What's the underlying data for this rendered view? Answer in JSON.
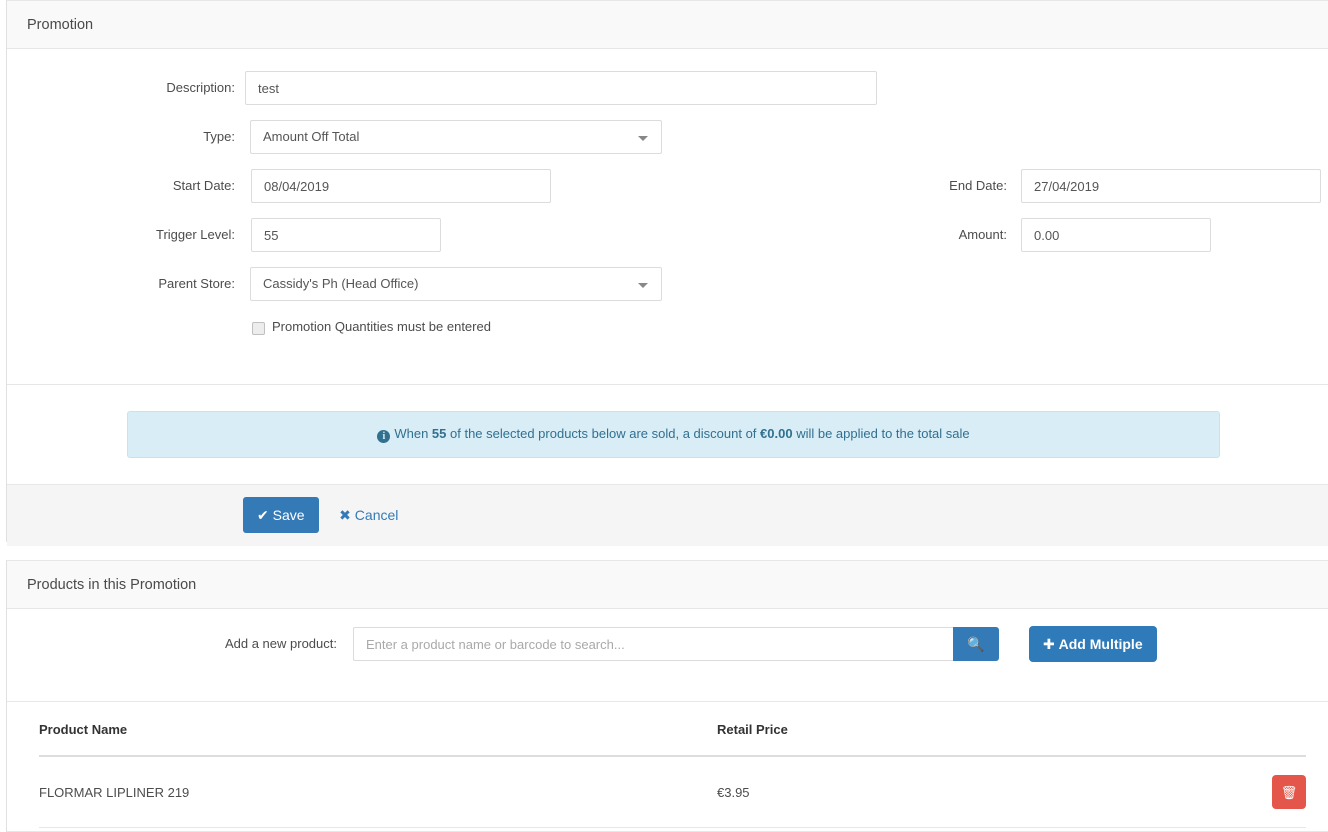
{
  "promotion_panel": {
    "title": "Promotion",
    "fields": {
      "description": {
        "label": "Description:",
        "value": "test"
      },
      "type": {
        "label": "Type:",
        "value": "Amount Off Total"
      },
      "start_date": {
        "label": "Start Date:",
        "value": "08/04/2019"
      },
      "end_date": {
        "label": "End Date:",
        "value": "27/04/2019"
      },
      "trigger_level": {
        "label": "Trigger Level:",
        "value": "55"
      },
      "amount": {
        "label": "Amount:",
        "value": "0.00"
      },
      "parent_store": {
        "label": "Parent Store:",
        "value": "Cassidy's Ph (Head Office)"
      }
    },
    "checkbox": {
      "label": "Promotion Quantities must be entered",
      "checked": false
    },
    "alert": {
      "icon": "info-circle-icon",
      "prefix": "When ",
      "trigger_value": "55",
      "middle": " of the selected products below are sold, a discount of ",
      "amount_value": "€0.00",
      "suffix": " will be applied to the total sale"
    },
    "footer": {
      "save_label": "Save",
      "save_icon": "✔",
      "cancel_label": "Cancel",
      "cancel_icon": "✖"
    }
  },
  "products_panel": {
    "title": "Products in this Promotion",
    "search": {
      "label": "Add a new product:",
      "placeholder": "Enter a product name or barcode to search...",
      "value": "",
      "search_icon": "🔍",
      "add_multiple_label": "Add Multiple",
      "add_multiple_icon": "✚"
    },
    "table": {
      "columns": [
        "Product Name",
        "Retail Price",
        ""
      ],
      "rows": [
        {
          "product_name": "FLORMAR LIPLINER 219",
          "retail_price": "€3.95",
          "delete_icon": "🗑"
        }
      ]
    }
  },
  "colors": {
    "primary": "#337ab7",
    "danger": "#e4564a",
    "alert_bg": "#d9edf7",
    "alert_border": "#bce8f1",
    "alert_text": "#31708f",
    "panel_heading_bg": "#f9f9f9",
    "panel_footer_bg": "#f5f5f5"
  }
}
